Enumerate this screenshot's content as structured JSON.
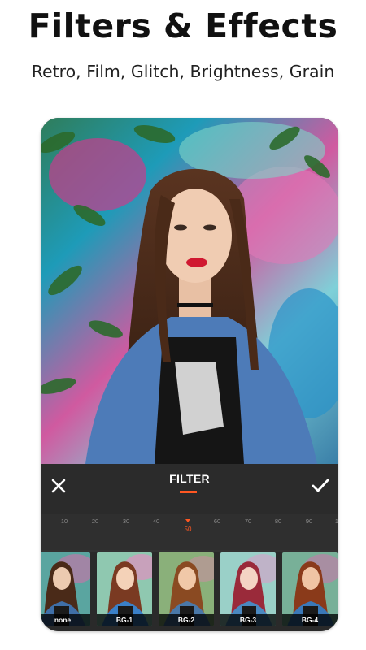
{
  "header": {
    "title": "Filters & Effects",
    "subtitle": "Retro, Film, Glitch, Brightness, Grain"
  },
  "editor": {
    "panel_title": "FILTER",
    "close_icon": "close-icon",
    "confirm_icon": "check-icon",
    "accent_color": "#ff5722",
    "slider": {
      "ticks": [
        "10",
        "20",
        "30",
        "40",
        "50",
        "60",
        "70",
        "80",
        "90",
        "1"
      ],
      "value": "50"
    },
    "filters": [
      {
        "label": "none"
      },
      {
        "label": "BG-1"
      },
      {
        "label": "BG-2"
      },
      {
        "label": "BG-3"
      },
      {
        "label": "BG-4"
      }
    ]
  }
}
